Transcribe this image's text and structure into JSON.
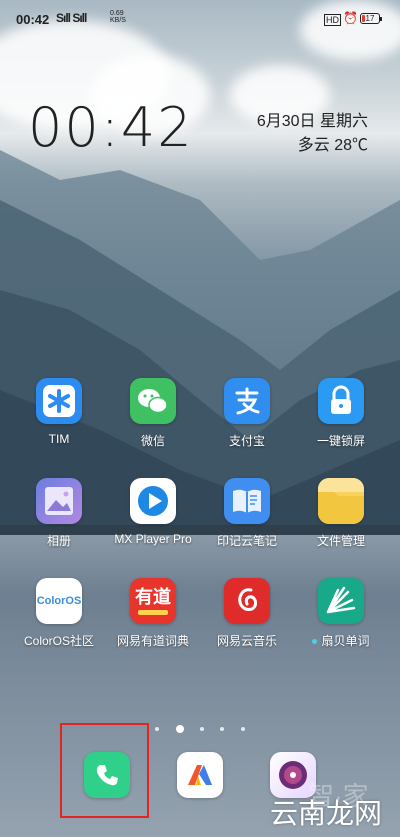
{
  "status_bar": {
    "time": "00:42",
    "signal": "Sıll Sıll",
    "net_speed_value": "0.69",
    "net_speed_unit": "KB/S",
    "hd": "HD",
    "battery": "17",
    "battery_level": 0.17
  },
  "lockclock": {
    "time": "00:42",
    "date": "6月30日 星期六",
    "weather": "多云 28℃"
  },
  "apps": [
    {
      "label": "TIM",
      "icon": "tim-icon"
    },
    {
      "label": "微信",
      "icon": "wechat-icon"
    },
    {
      "label": "支付宝",
      "icon": "alipay-icon"
    },
    {
      "label": "一键锁屏",
      "icon": "lock-icon"
    },
    {
      "label": "相册",
      "icon": "gallery-icon"
    },
    {
      "label": "MX Player Pro",
      "icon": "play-icon"
    },
    {
      "label": "印记云笔记",
      "icon": "notebook-icon"
    },
    {
      "label": "文件管理",
      "icon": "folder-icon"
    },
    {
      "label": "ColorOS社区",
      "icon": "coloros-icon"
    },
    {
      "label": "网易有道词典",
      "icon": "youdao-icon"
    },
    {
      "label": "网易云音乐",
      "icon": "netease-music-icon"
    },
    {
      "label": "扇贝单词",
      "icon": "shanbay-icon"
    }
  ],
  "app_text": {
    "coloros_logo": "ColorOS",
    "youdao_logo": "有道"
  },
  "dock": [
    {
      "name": "phone",
      "icon": "phone-icon"
    },
    {
      "name": "yinxiang",
      "icon": "yinxiang-icon"
    },
    {
      "name": "music-player",
      "icon": "music-disc-icon"
    }
  ],
  "page_indicator": {
    "pages": 6,
    "active": 1
  },
  "watermark": {
    "text": "云南龙网",
    "ghost": "智·家"
  }
}
